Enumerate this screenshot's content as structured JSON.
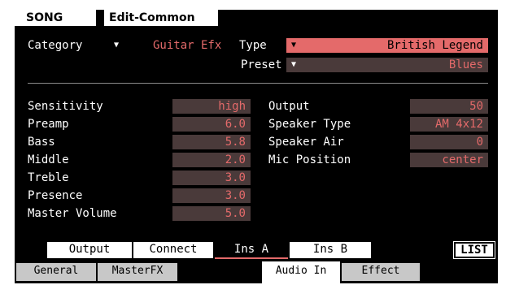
{
  "header": {
    "mode": "SONG",
    "screen": "Edit-Common"
  },
  "top": {
    "category_label": "Category",
    "category_value": "Guitar Efx",
    "type_label": "Type",
    "type_value": "British Legend",
    "preset_label": "Preset",
    "preset_value": "Blues"
  },
  "params_left": [
    {
      "label": "Sensitivity",
      "value": "high"
    },
    {
      "label": "Preamp",
      "value": "6.0"
    },
    {
      "label": "Bass",
      "value": "5.8"
    },
    {
      "label": "Middle",
      "value": "2.0"
    },
    {
      "label": "Treble",
      "value": "3.0"
    },
    {
      "label": "Presence",
      "value": "3.0"
    },
    {
      "label": "Master Volume",
      "value": "5.0"
    }
  ],
  "params_right": [
    {
      "label": "Output",
      "value": "50"
    },
    {
      "label": "Speaker Type",
      "value": "AM 4x12"
    },
    {
      "label": "Speaker Air",
      "value": "0"
    },
    {
      "label": "Mic Position",
      "value": "center"
    }
  ],
  "tabs": {
    "output": "Output",
    "connect": "Connect",
    "ins_a": "Ins A",
    "ins_b": "Ins B",
    "list": "LIST"
  },
  "subtabs": {
    "general": "General",
    "masterfx": "MasterFX",
    "audio_in": "Audio In",
    "effect": "Effect"
  },
  "colors": {
    "background": "#000000",
    "value_text": "#e46a6a",
    "value_bg": "#4a3a3a",
    "highlight": "#e46a6a"
  }
}
